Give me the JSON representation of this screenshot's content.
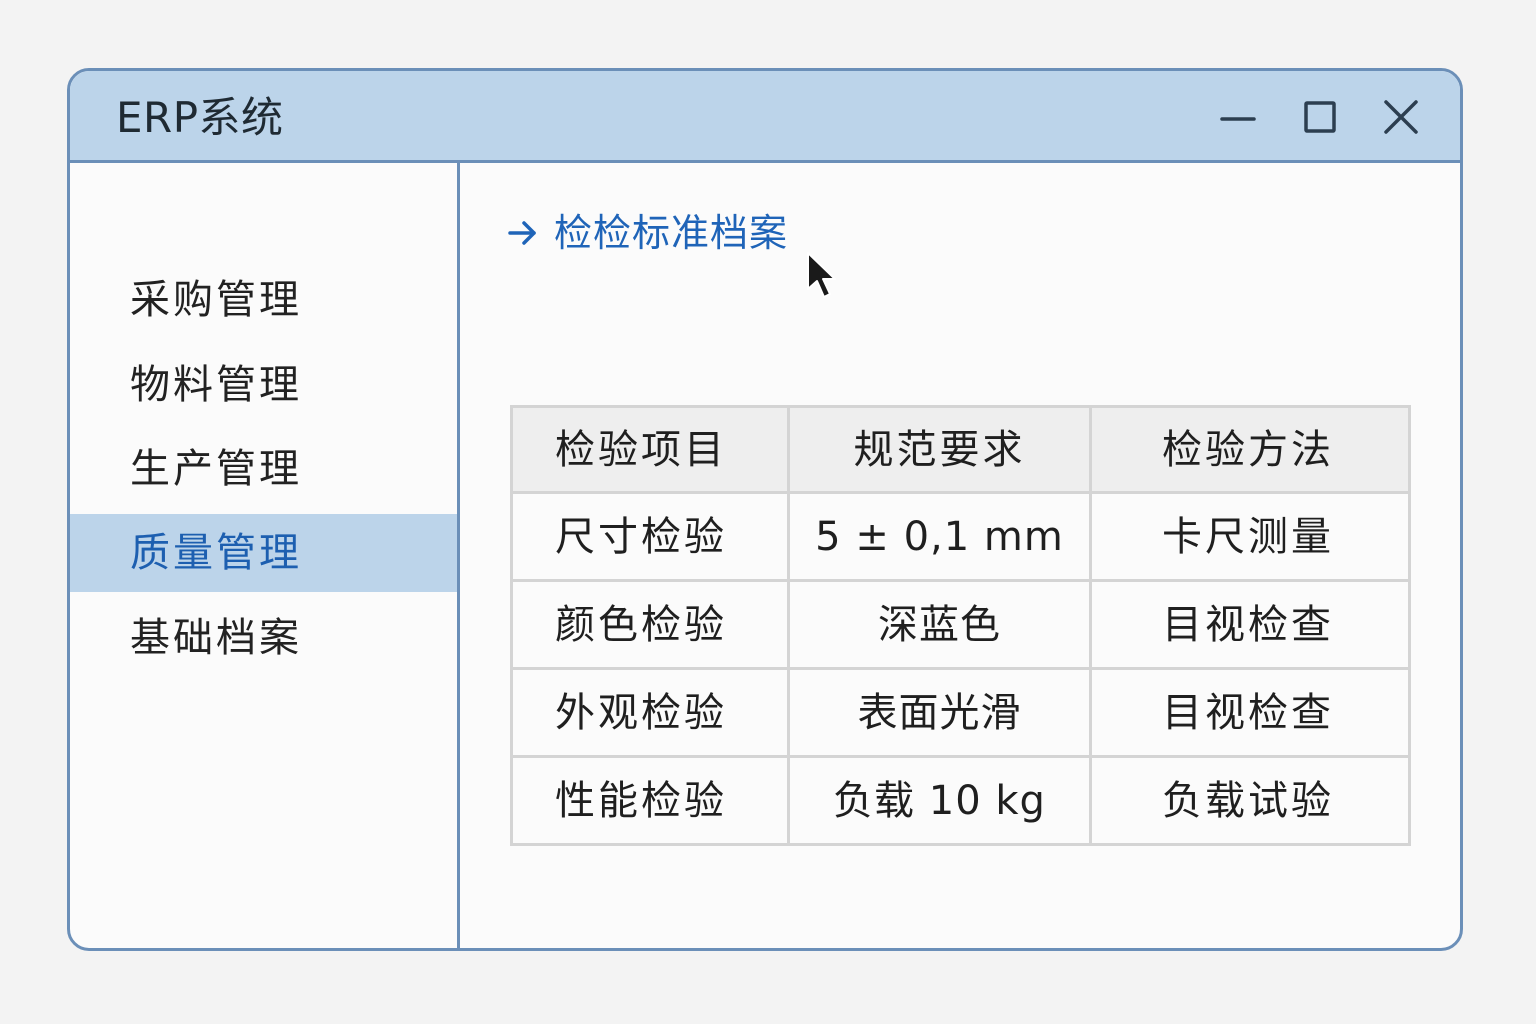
{
  "window": {
    "title": "ERP系统",
    "controls": {
      "minimize_icon": "minimize-icon",
      "maximize_icon": "maximize-icon",
      "close_icon": "close-icon"
    }
  },
  "sidebar": {
    "items": [
      {
        "label": "采购管理",
        "active": false
      },
      {
        "label": "物料管理",
        "active": false
      },
      {
        "label": "生产管理",
        "active": false
      },
      {
        "label": "质量管理",
        "active": true
      },
      {
        "label": "基础档案",
        "active": false
      }
    ]
  },
  "breadcrumb": {
    "icon": "arrow-right-icon",
    "label": "检检标准档案"
  },
  "table": {
    "headers": [
      "检验项目",
      "规范要求",
      "检验方法"
    ],
    "rows": [
      [
        "尺寸检验",
        "5 ± 0,1 mm",
        "卡尺测量"
      ],
      [
        "颜色检验",
        "深蓝色",
        "目视检查"
      ],
      [
        "外观检验",
        "表面光滑",
        "目视检查"
      ],
      [
        "性能检验",
        "负载 10 kg",
        "负载试验"
      ]
    ]
  },
  "colors": {
    "titlebar_bg": "#bcd4ea",
    "border": "#6b8fb8",
    "accent_text": "#1d5fb0",
    "active_nav_bg": "#bcd4ea",
    "table_header_bg": "#eeeeee"
  }
}
